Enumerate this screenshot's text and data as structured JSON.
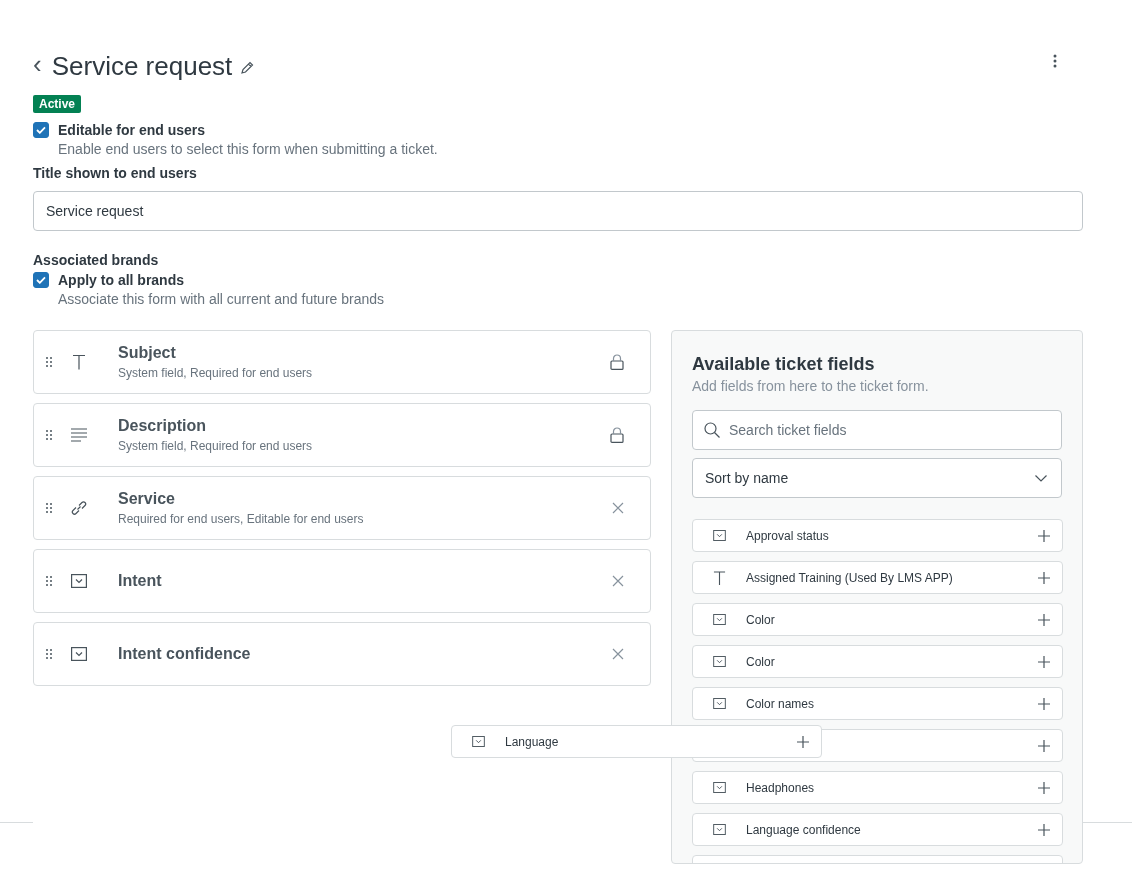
{
  "header": {
    "back": "‹",
    "title": "Service request",
    "status": "Active"
  },
  "editable": {
    "label": "Editable for end users",
    "hint": "Enable end users to select this form when submitting a ticket.",
    "checked": true
  },
  "title_field": {
    "label": "Title shown to end users",
    "value": "Service request"
  },
  "brands": {
    "heading": "Associated brands",
    "label": "Apply to all brands",
    "hint": "Associate this form with all current and future brands",
    "checked": true
  },
  "form_fields": [
    {
      "name": "Subject",
      "detail": "System field, Required for end users",
      "kind": "text",
      "locked": true
    },
    {
      "name": "Description",
      "detail": "System field, Required for end users",
      "kind": "multiline",
      "locked": true
    },
    {
      "name": "Service",
      "detail": "Required for end users, Editable for end users",
      "kind": "lookup",
      "locked": false
    },
    {
      "name": "Intent",
      "kind": "dropdown",
      "locked": false
    },
    {
      "name": "Intent confidence",
      "kind": "dropdown",
      "locked": false
    }
  ],
  "available": {
    "title": "Available ticket fields",
    "subtitle": "Add fields from here to the ticket form.",
    "search_placeholder": "Search ticket fields",
    "sort": "Sort by name",
    "items": [
      {
        "name": "Approval status",
        "kind": "dropdown"
      },
      {
        "name": "Assigned Training (Used By LMS APP)",
        "kind": "text"
      },
      {
        "name": "Color",
        "kind": "dropdown"
      },
      {
        "name": "Color",
        "kind": "dropdown"
      },
      {
        "name": "Color names",
        "kind": "dropdown"
      },
      {
        "kind": "hidden"
      },
      {
        "name": "Headphones",
        "kind": "dropdown"
      },
      {
        "name": "Language confidence",
        "kind": "dropdown"
      },
      {
        "kind": "blank"
      }
    ]
  },
  "dragged_item": {
    "name": "Language",
    "kind": "dropdown"
  }
}
